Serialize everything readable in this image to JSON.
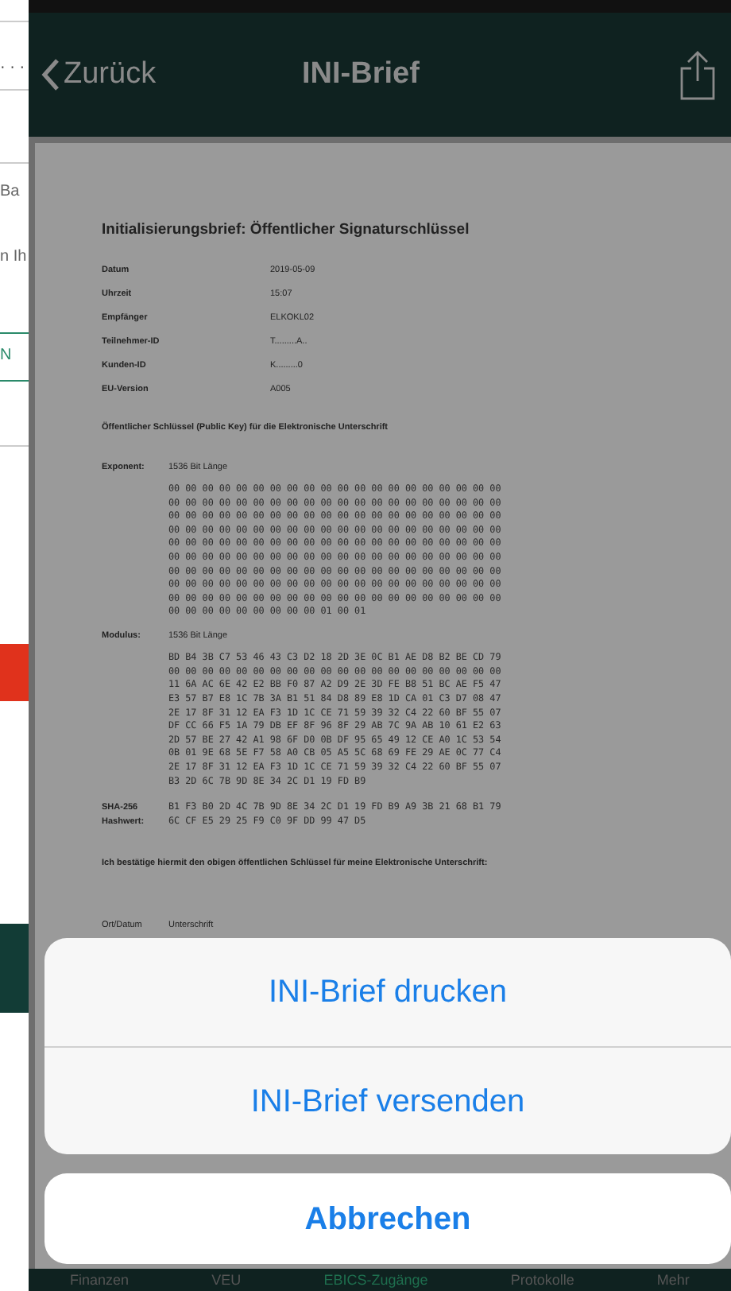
{
  "background_app": {
    "dots": "· · ·",
    "texts": [
      "Ba",
      "n Ih"
    ],
    "link": "N"
  },
  "nav": {
    "back": "Zurück",
    "title": "INI-Brief"
  },
  "document": {
    "title": "Initialisierungsbrief: Öffentlicher Signaturschlüssel",
    "fields": [
      {
        "label": "Datum",
        "value": "2019-05-09"
      },
      {
        "label": "Uhrzeit",
        "value": "15:07"
      },
      {
        "label": "Empfänger",
        "value": "ELKOKL02"
      },
      {
        "label": "Teilnehmer-ID",
        "value": "T.........A.."
      },
      {
        "label": "Kunden-ID",
        "value": "K.........0"
      },
      {
        "label": "EU-Version",
        "value": "A005"
      }
    ],
    "key_heading": "Öffentlicher Schlüssel (Public Key) für die Elektronische Unterschrift",
    "exponent": {
      "label": "Exponent:",
      "length": "1536 Bit Länge",
      "rows": [
        "00 00 00 00 00 00 00 00 00 00 00 00 00 00 00 00 00 00 00 00",
        "00 00 00 00 00 00 00 00 00 00 00 00 00 00 00 00 00 00 00 00",
        "00 00 00 00 00 00 00 00 00 00 00 00 00 00 00 00 00 00 00 00",
        "00 00 00 00 00 00 00 00 00 00 00 00 00 00 00 00 00 00 00 00",
        "00 00 00 00 00 00 00 00 00 00 00 00 00 00 00 00 00 00 00 00",
        "00 00 00 00 00 00 00 00 00 00 00 00 00 00 00 00 00 00 00 00",
        "00 00 00 00 00 00 00 00 00 00 00 00 00 00 00 00 00 00 00 00",
        "00 00 00 00 00 00 00 00 00 00 00 00 00 00 00 00 00 00 00 00",
        "00 00 00 00 00 00 00 00 00 00 00 00 00 00 00 00 00 00 00 00",
        "00 00 00 00 00 00 00 00 00 01 00 01"
      ]
    },
    "modulus": {
      "label": "Modulus:",
      "length": "1536 Bit Länge",
      "rows": [
        "BD B4 3B C7 53 46 43 C3 D2 18 2D 3E 0C B1 AE D8 B2 BE CD 79",
        "00 00 00 00 00 00 00 00 00 00 00 00 00 00 00 00 00 00 00 00",
        "11 6A AC 6E 42 E2 BB F0 87 A2 D9 2E 3D FE B8 51 BC AE F5 47",
        "E3 57 B7 E8 1C 7B 3A B1 51 84 D8 89 E8 1D CA 01 C3 D7 08 47",
        "2E 17 8F 31 12 EA F3 1D 1C CE 71 59 39 32 C4 22 60 BF 55 07",
        "DF CC 66 F5 1A 79 DB EF 8F 96 8F 29 AB 7C 9A AB 10 61 E2 63",
        "2D 57 BE 27 42 A1 98 6F D0 0B DF 95 65 49 12 CE A0 1C 53 54",
        "0B 01 9E 68 5E F7 58 A0 CB 05 A5 5C 68 69 FE 29 AE 0C 77 C4",
        "2E 17 8F 31 12 EA F3 1D 1C CE 71 59 39 32 C4 22 60 BF 55 07",
        "B3 2D 6C 7B 9D 8E 34 2C D1 19 FD B9"
      ]
    },
    "hash": {
      "label_lines": [
        "SHA-256",
        "Hashwert:"
      ],
      "rows": [
        "B1 F3 B0 2D 4C 7B 9D 8E 34 2C D1 19 FD B9 A9 3B 21 68 B1 79",
        "6C CF E5 29 25 F9 C0 9F DD 99 47 D5"
      ]
    },
    "confirmation": "Ich bestätige hiermit den obigen öffentlichen Schlüssel für meine Elektronische Unterschrift:",
    "signature_labels": [
      "Ort/Datum",
      "Unterschrift"
    ]
  },
  "action_sheet": {
    "actions": [
      "INI-Brief drucken",
      "INI-Brief versenden"
    ],
    "cancel": "Abbrechen"
  },
  "tab_bar": [
    {
      "label": "Finanzen",
      "selected": false
    },
    {
      "label": "VEU",
      "selected": false
    },
    {
      "label": "EBICS-Zugänge",
      "selected": true
    },
    {
      "label": "Protokolle",
      "selected": false
    },
    {
      "label": "Mehr",
      "selected": false
    }
  ]
}
